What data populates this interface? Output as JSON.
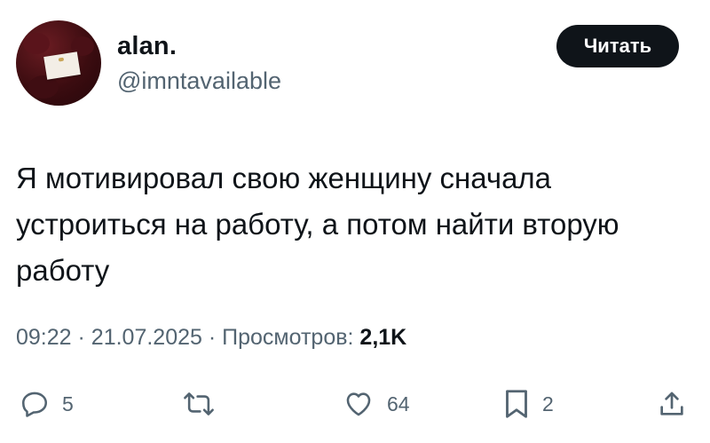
{
  "author": {
    "display_name": "alan.",
    "handle": "@imntavailable"
  },
  "follow_button": {
    "label": "Читать"
  },
  "tweet": {
    "lines": [
      "Я мотивировал свою женщину сначала",
      "устроиться на работу, а потом найти вторую",
      "работу"
    ]
  },
  "meta": {
    "time": "09:22",
    "separator": "·",
    "date": "21.07.2025",
    "views_label": "Просмотров:",
    "views_count": "2,1K"
  },
  "actions": {
    "reply_count": "5",
    "retweet_count": "",
    "like_count": "64",
    "bookmark_count": "2"
  },
  "icons": {
    "reply": "reply-icon",
    "retweet": "retweet-icon",
    "like": "heart-icon",
    "bookmark": "bookmark-icon",
    "share": "share-icon"
  },
  "colors": {
    "text_primary": "#0f1419",
    "text_secondary": "#536471",
    "button_bg": "#0f1419",
    "button_text": "#ffffff"
  }
}
